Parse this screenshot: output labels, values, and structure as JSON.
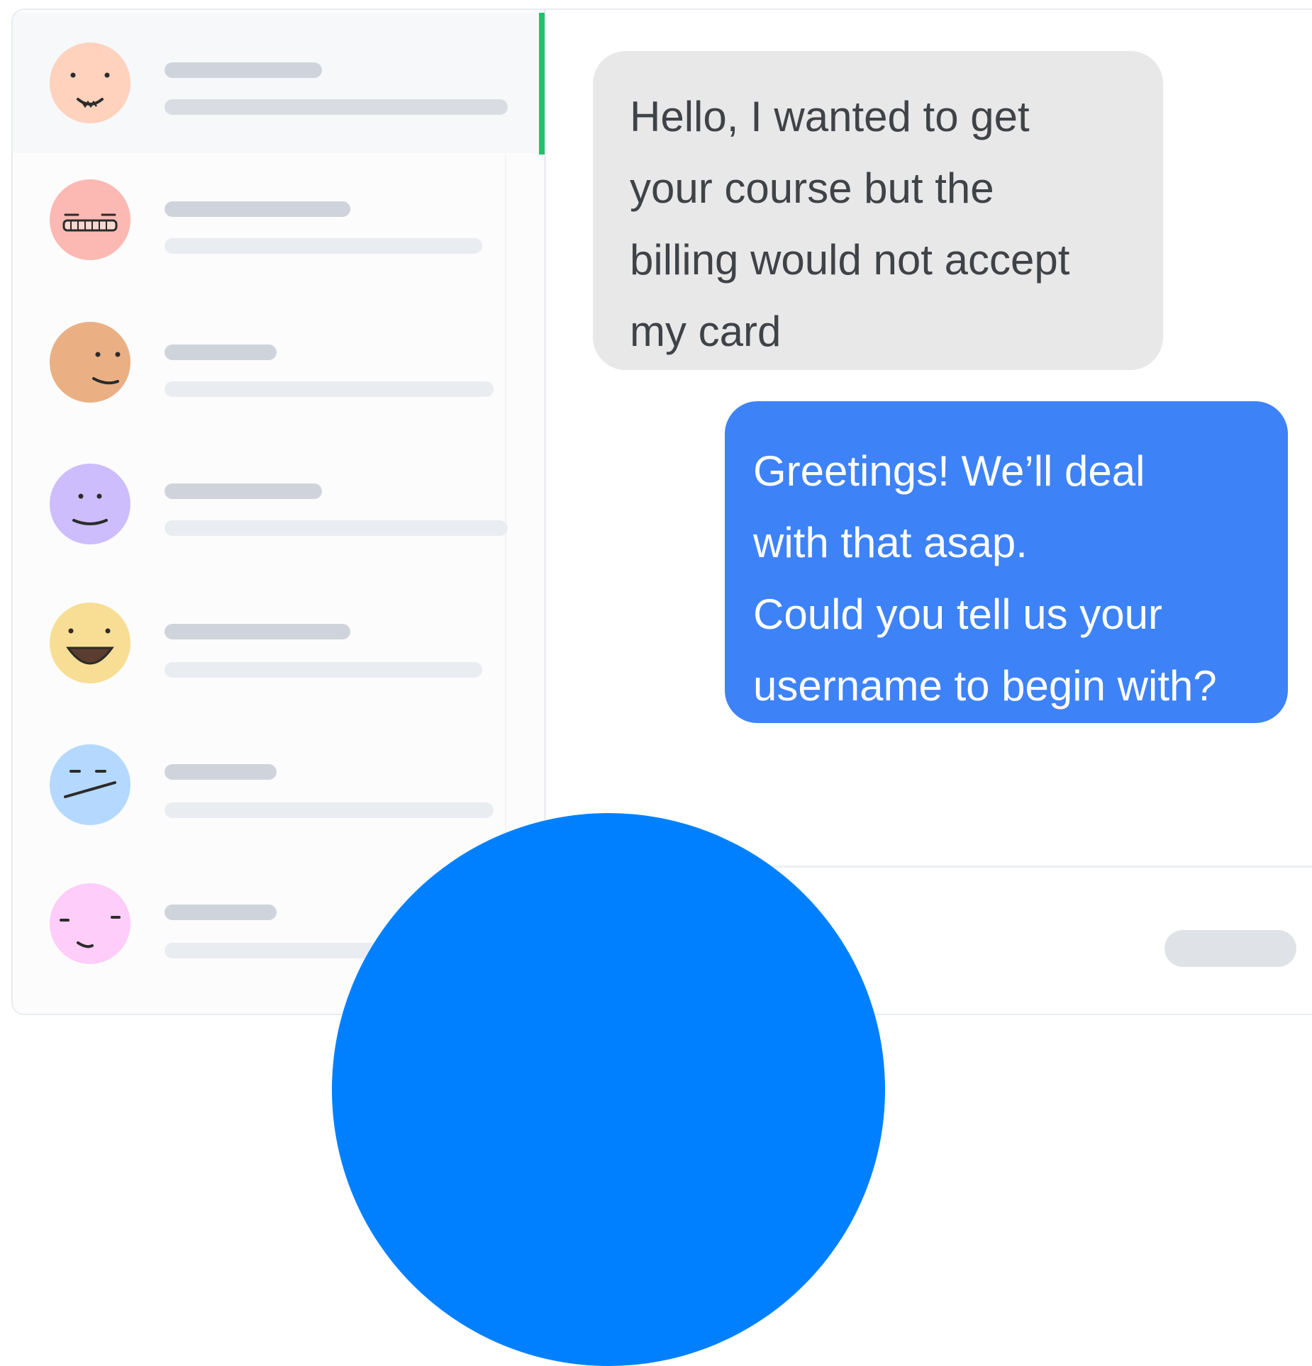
{
  "window": {
    "conversations": [
      {
        "avatar": "smiling-face-icon",
        "avatar_color": "#fed2bd",
        "active": true
      },
      {
        "avatar": "grimacing-face-icon",
        "avatar_color": "#fcb9b3"
      },
      {
        "avatar": "smirking-face-icon",
        "avatar_color": "#eab084"
      },
      {
        "avatar": "content-face-icon",
        "avatar_color": "#cdbdfd"
      },
      {
        "avatar": "laughing-face-icon",
        "avatar_color": "#f8de94"
      },
      {
        "avatar": "unamused-face-icon",
        "avatar_color": "#b5d9fe"
      },
      {
        "avatar": "winking-face-icon",
        "avatar_color": "#fecdf9"
      }
    ],
    "active_indicator_color": "#1fc26b"
  },
  "chat": {
    "messages": [
      {
        "direction": "incoming",
        "text": "Hello, I wanted to get\nyour course but the\nbilling would not accept\nmy card"
      },
      {
        "direction": "outgoing",
        "text": "Greetings! We’ll deal\nwith that asap.\nCould you tell us your\nusername to begin with?"
      }
    ],
    "incoming_bubble_color": "#e8e8e9",
    "outgoing_bubble_color": "#3e82f7"
  },
  "fab": {
    "color": "#0080ff"
  }
}
